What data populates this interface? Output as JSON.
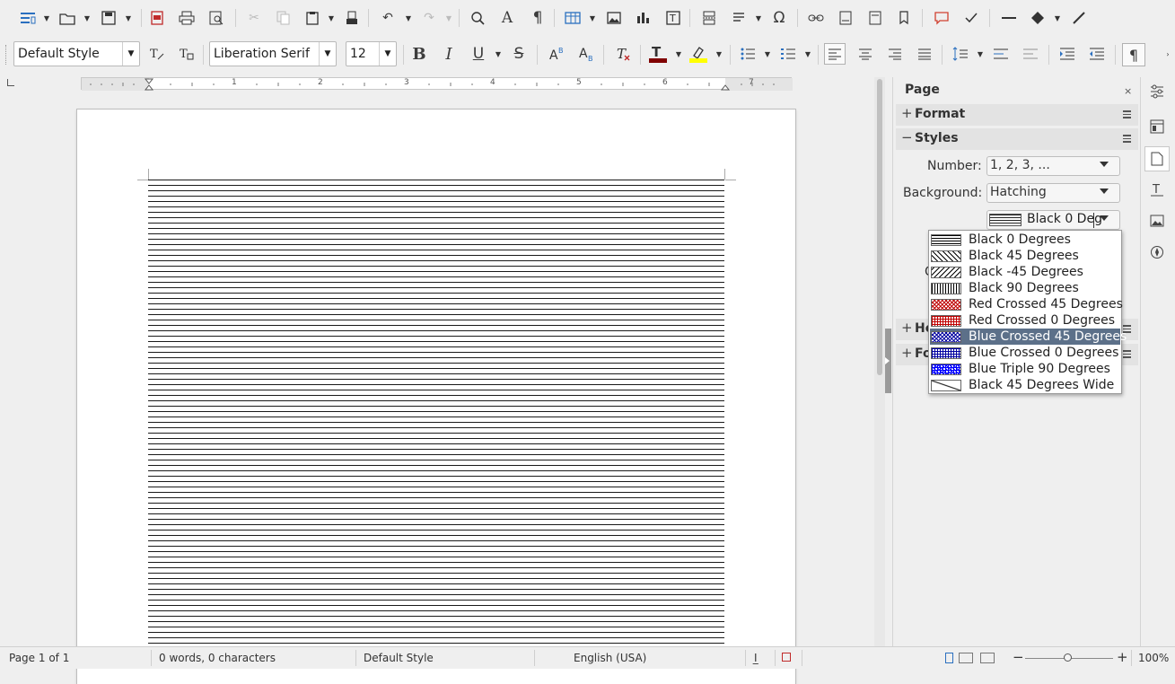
{
  "toolbar": {
    "paragraph_style": "Default Style",
    "font_name": "Liberation Serif",
    "font_size": "12",
    "bold": "B",
    "italic": "I",
    "underline": "U",
    "strike": "S"
  },
  "ruler": {
    "numbers": [
      "1",
      "2",
      "3",
      "4",
      "5",
      "6",
      "7"
    ]
  },
  "sidebar": {
    "title": "Page",
    "close": "×",
    "sections": {
      "format": "Format",
      "styles": "Styles",
      "header": "He",
      "footer": "Fo"
    },
    "number_label": "Number:",
    "number_value": "1, 2, 3, ...",
    "background_label": "Background:",
    "background_value": "Hatching",
    "hatch_value": "Black 0 Deg",
    "hidden_label": "C"
  },
  "hatch_dropdown": {
    "items": [
      {
        "label": "Black 0 Degrees",
        "color": "#000000",
        "pattern": "h"
      },
      {
        "label": "Black 45 Degrees",
        "color": "#000000",
        "pattern": "d45"
      },
      {
        "label": "Black -45 Degrees",
        "color": "#000000",
        "pattern": "dm45"
      },
      {
        "label": "Black 90 Degrees",
        "color": "#000000",
        "pattern": "v"
      },
      {
        "label": "Red Crossed 45 Degrees",
        "color": "#c00000",
        "pattern": "x45"
      },
      {
        "label": "Red Crossed 0 Degrees",
        "color": "#c00000",
        "pattern": "x0"
      },
      {
        "label": "Blue Crossed 45 Degrees",
        "color": "#0000a0",
        "pattern": "x45"
      },
      {
        "label": "Blue Crossed 0 Degrees",
        "color": "#0000a0",
        "pattern": "x0"
      },
      {
        "label": "Blue Triple 90 Degrees",
        "color": "#0000ff",
        "pattern": "t"
      },
      {
        "label": "Black 45 Degrees Wide",
        "color": "#000000",
        "pattern": "wide"
      }
    ],
    "selected": "Blue Crossed 45 Degrees"
  },
  "status": {
    "page": "Page 1 of 1",
    "words": "0 words, 0 characters",
    "style": "Default Style",
    "language": "English (USA)",
    "zoom": "100%"
  }
}
